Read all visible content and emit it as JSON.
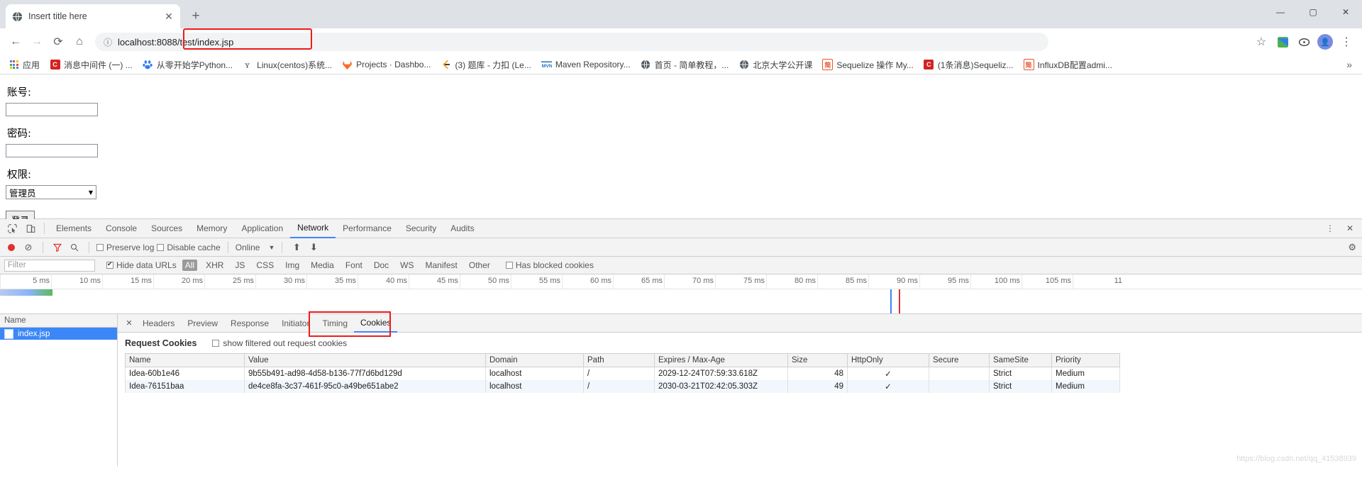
{
  "browser": {
    "tab_title": "Insert title here",
    "tab_close": "✕",
    "new_tab": "+",
    "window_minimize": "—",
    "window_maximize": "▢",
    "window_close": "✕",
    "nav": {
      "back": "←",
      "forward": "→",
      "reload": "⟳",
      "home": "⌂",
      "site_info": "ⓘ",
      "url": "localhost:8088/test/index.jsp",
      "star": "☆",
      "menu": "⋮"
    },
    "bookmarks": [
      {
        "label": "应用",
        "icon": "apps-grid-icon",
        "kind": "apps"
      },
      {
        "label": "消息中间件 (一) ...",
        "icon": "csdn-icon",
        "kind": "csdn"
      },
      {
        "label": "从零开始学Python...",
        "icon": "baidu-icon",
        "kind": "baidu"
      },
      {
        "label": "Linux(centos)系统...",
        "icon": "script-icon",
        "kind": "script"
      },
      {
        "label": "Projects · Dashbo...",
        "icon": "gitlab-icon",
        "kind": "gitlab"
      },
      {
        "label": "(3) 题库 - 力扣 (Le...",
        "icon": "leetcode-icon",
        "kind": "leetcode"
      },
      {
        "label": "Maven Repository...",
        "icon": "maven-icon",
        "kind": "maven"
      },
      {
        "label": "首页 - 简单教程，...",
        "icon": "globe-icon",
        "kind": "globe"
      },
      {
        "label": "北京大学公开课",
        "icon": "globe-icon",
        "kind": "globe"
      },
      {
        "label": "Sequelize 操作 My...",
        "icon": "jian-icon",
        "kind": "jian"
      },
      {
        "label": "(1条消息)Sequeliz...",
        "icon": "csdn-icon",
        "kind": "csdn"
      },
      {
        "label": "InfluxDB配置admi...",
        "icon": "jian-icon",
        "kind": "jian"
      }
    ],
    "bookmark_overflow": "»"
  },
  "page": {
    "account_label": "账号:",
    "account_value": "",
    "password_label": "密码:",
    "password_value": "",
    "permission_label": "权限:",
    "permission_value": "管理员",
    "permission_caret": "▼",
    "login_button": "登录"
  },
  "devtools": {
    "inspect_icon": "⊾",
    "device_icon": "❏",
    "tabs": [
      {
        "label": "Elements",
        "active": false
      },
      {
        "label": "Console",
        "active": false
      },
      {
        "label": "Sources",
        "active": false
      },
      {
        "label": "Memory",
        "active": false
      },
      {
        "label": "Application",
        "active": false
      },
      {
        "label": "Network",
        "active": true
      },
      {
        "label": "Performance",
        "active": false
      },
      {
        "label": "Security",
        "active": false
      },
      {
        "label": "Audits",
        "active": false
      }
    ],
    "more_icon": "⋮",
    "close_icon": "✕",
    "toolbar": {
      "record": "record-icon",
      "clear": "⊘",
      "filter": "filter-icon",
      "search": "🔍",
      "preserve_log": "Preserve log",
      "preserve_log_checked": false,
      "disable_cache": "Disable cache",
      "disable_cache_checked": false,
      "throttle": "Online",
      "throttle_caret": "▼",
      "import_icon": "⬆",
      "export_icon": "⬇",
      "settings_icon": "⚙"
    },
    "filterbar": {
      "filter_placeholder": "Filter",
      "filter_value": "",
      "hide_data_urls": "Hide data URLs",
      "hide_data_urls_checked": true,
      "types": [
        "All",
        "XHR",
        "JS",
        "CSS",
        "Img",
        "Media",
        "Font",
        "Doc",
        "WS",
        "Manifest",
        "Other"
      ],
      "selected_type": "All",
      "has_blocked_cookies": "Has blocked cookies",
      "has_blocked_cookies_checked": false
    },
    "timeline_ticks": [
      "5 ms",
      "10 ms",
      "15 ms",
      "20 ms",
      "25 ms",
      "30 ms",
      "35 ms",
      "40 ms",
      "45 ms",
      "50 ms",
      "55 ms",
      "60 ms",
      "65 ms",
      "70 ms",
      "75 ms",
      "80 ms",
      "85 ms",
      "90 ms",
      "95 ms",
      "100 ms",
      "105 ms",
      "11"
    ],
    "requests_header": "Name",
    "requests": [
      {
        "name": "index.jsp",
        "selected": true
      }
    ],
    "detail_tabs": [
      {
        "label": "Headers",
        "active": false
      },
      {
        "label": "Preview",
        "active": false
      },
      {
        "label": "Response",
        "active": false
      },
      {
        "label": "Initiator",
        "active": false
      },
      {
        "label": "Timing",
        "active": false
      },
      {
        "label": "Cookies",
        "active": true
      }
    ],
    "detail_close": "✕",
    "cookies_section": {
      "title": "Request Cookies",
      "show_filtered_label": "show filtered out request cookies",
      "show_filtered_checked": false,
      "columns": [
        "Name",
        "Value",
        "Domain",
        "Path",
        "Expires / Max-Age",
        "Size",
        "HttpOnly",
        "Secure",
        "SameSite",
        "Priority"
      ],
      "rows": [
        {
          "name": "Idea-60b1e46",
          "value": "9b55b491-ad98-4d58-b136-77f7d6bd129d",
          "domain": "localhost",
          "path": "/",
          "expires": "2029-12-24T07:59:33.618Z",
          "size": "48",
          "httponly": "✓",
          "secure": "",
          "samesite": "Strict",
          "priority": "Medium"
        },
        {
          "name": "Idea-76151baa",
          "value": "de4ce8fa-3c37-461f-95c0-a49be651abe2",
          "domain": "localhost",
          "path": "/",
          "expires": "2030-03-21T02:42:05.303Z",
          "size": "49",
          "httponly": "✓",
          "secure": "",
          "samesite": "Strict",
          "priority": "Medium"
        }
      ]
    }
  },
  "watermark": "https://blog.csdn.net/qq_41538939"
}
